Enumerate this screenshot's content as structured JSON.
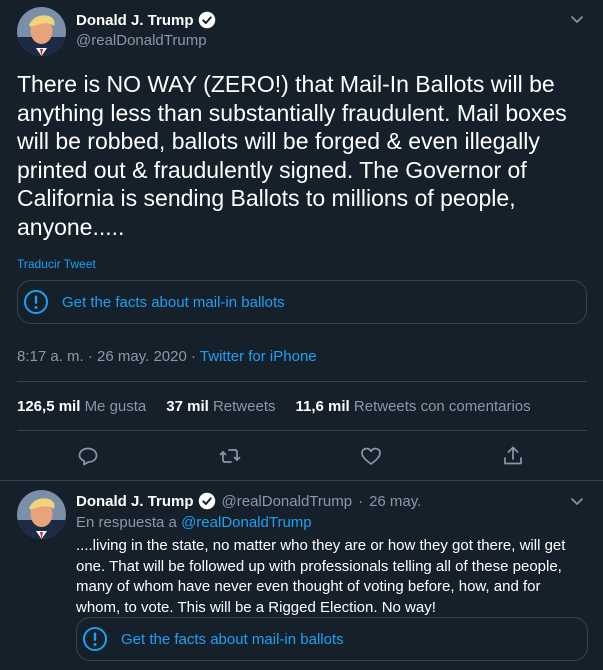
{
  "tweet": {
    "author_name": "Donald J. Trump",
    "author_handle": "@realDonaldTrump",
    "text": "There is NO WAY (ZERO!) that Mail-In Ballots will be anything less than substantially fraudulent. Mail boxes will be robbed, ballots will be forged & even illegally printed out & fraudulently signed. The Governor of California is sending Ballots to millions of people, anyone.....",
    "translate_label": "Traducir Tweet",
    "facts_label": "Get the facts about mail-in ballots",
    "time": "8:17 a. m.",
    "date_sep": "·",
    "date": "26 may. 2020",
    "source_sep": "·",
    "source": "Twitter for iPhone",
    "stats": [
      {
        "count": "126,5 mil",
        "label": "Me gusta"
      },
      {
        "count": "37 mil",
        "label": "Retweets"
      },
      {
        "count": "11,6 mil",
        "label": "Retweets con comentarios"
      }
    ],
    "icons": [
      "reply-icon",
      "retweet-icon",
      "like-icon",
      "share-icon"
    ]
  },
  "reply": {
    "author_name": "Donald J. Trump",
    "author_handle": "@realDonaldTrump",
    "sep": "·",
    "date": "26 may.",
    "reply_prefix": "En respuesta a",
    "reply_handle": "@realDonaldTrump",
    "text": "....living in the state, no matter who they are or how they got there, will get one. That will be followed up with professionals telling all of these people, many of whom have never even thought of voting before, how, and for whom, to vote. This will be a Rigged Election. No way!",
    "facts_label": "Get the facts about mail-in ballots"
  },
  "colors": {
    "background": "#15202b",
    "accent": "#1da1f2",
    "secondary_text": "#8899a6",
    "divider": "#38444d"
  }
}
